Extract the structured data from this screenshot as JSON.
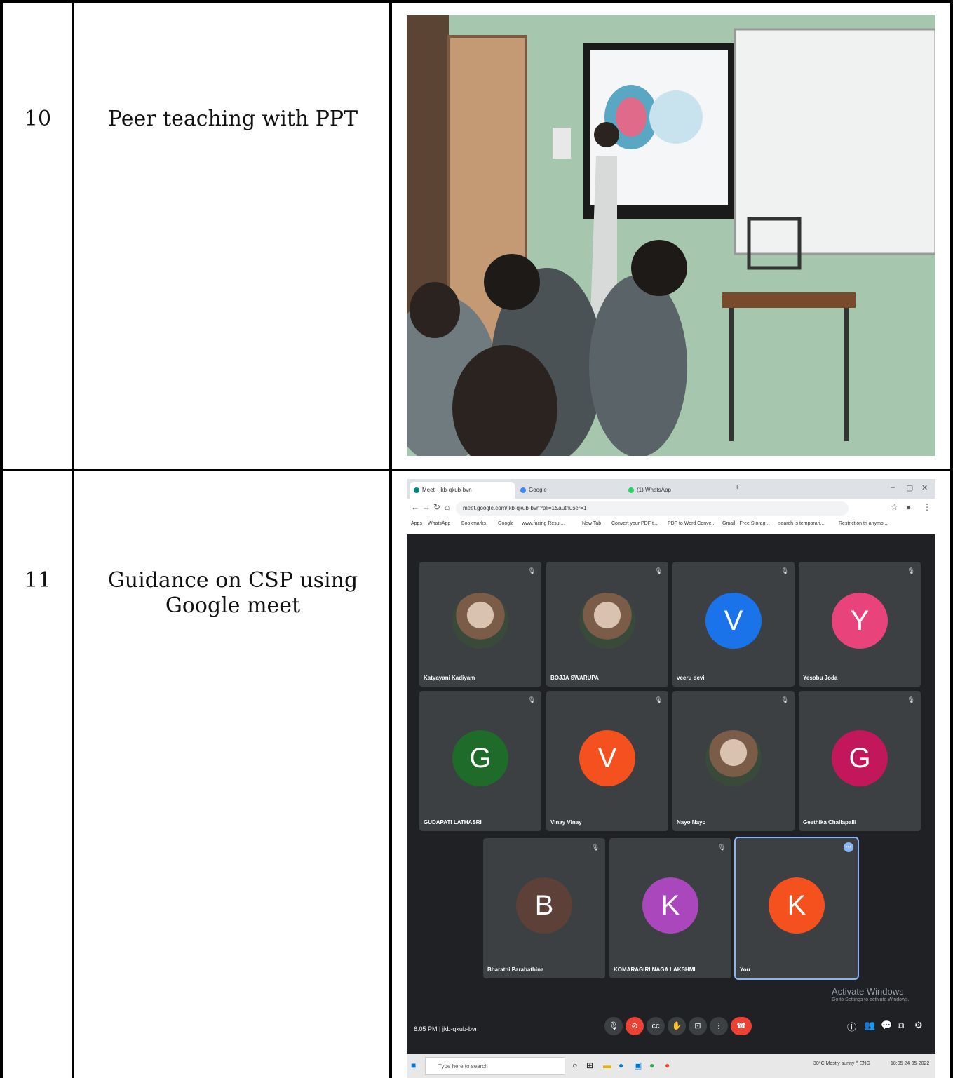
{
  "rows": [
    {
      "number": "10",
      "activity": "Peer teaching with PPT"
    },
    {
      "number": "11",
      "activity": "Guidance on CSP using Google meet"
    }
  ],
  "meet": {
    "tabs": [
      "Meet - jkb-qkub-bvn",
      "Google",
      "(1) WhatsApp"
    ],
    "url": "meet.google.com/jkb-qkub-bvn?pli=1&authuser=1",
    "bookmarks": [
      "Apps",
      "WhatsApp",
      "Bookmarks",
      "Google",
      "www.facing Resul...",
      "New Tab",
      "Convert your PDF t...",
      "PDF to Word Conve...",
      "Gmail - Free Storag...",
      "search is temporari...",
      "Restriction tri anymo..."
    ],
    "participants": [
      {
        "name": "Katyayani Kadiyam",
        "initial": "",
        "color": ""
      },
      {
        "name": "BOJJA SWARUPA",
        "initial": "",
        "color": ""
      },
      {
        "name": "veeru devi",
        "initial": "V",
        "color": "#1a73e8"
      },
      {
        "name": "Yesobu Joda",
        "initial": "Y",
        "color": "#e8437a"
      },
      {
        "name": "GUDAPATI LATHASRI",
        "initial": "G",
        "color": "#1e6b2a"
      },
      {
        "name": "Vinay Vinay",
        "initial": "V",
        "color": "#f4511e"
      },
      {
        "name": "Nayo Nayo",
        "initial": "",
        "color": ""
      },
      {
        "name": "Geethika Challapalli",
        "initial": "G",
        "color": "#c2185b"
      },
      {
        "name": "Bharathi Parabathina",
        "initial": "B",
        "color": "#5d4037"
      },
      {
        "name": "KOMARAGIRI NAGA LAKSHMI",
        "initial": "K",
        "color": "#ab47bc"
      },
      {
        "name": "You",
        "initial": "K",
        "color": "#f4511e"
      }
    ],
    "time_code": "6:05 PM  |  jkb-qkub-bvn",
    "activate_title": "Activate Windows",
    "activate_sub": "Go to Settings to activate Windows.",
    "taskbar_search": "Type here to search",
    "tray_text": "30°C Mostly sunny  ^  ENG",
    "tray_clock": "18:05  24-05-2022"
  },
  "icons": {
    "mic": "mic-icon",
    "cam": "camera-icon",
    "end": "end-call-icon"
  }
}
